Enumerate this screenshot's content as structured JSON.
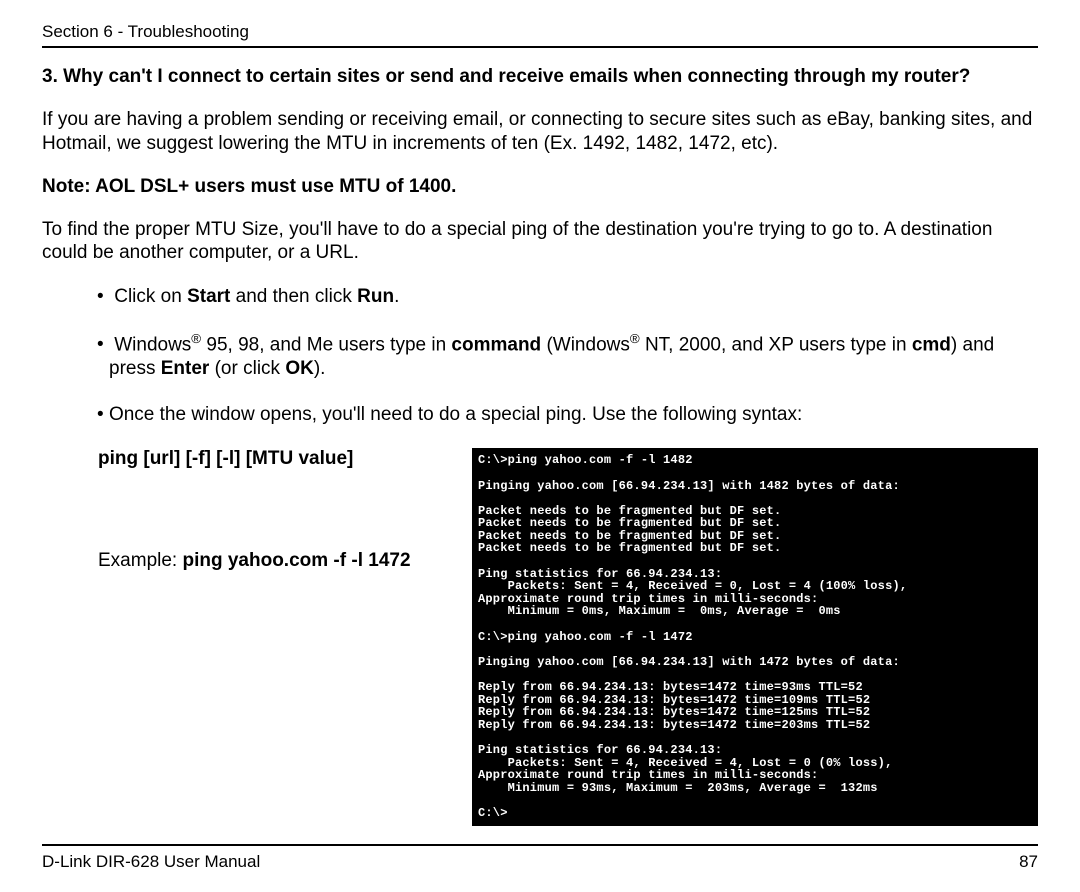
{
  "header": "Section 6 - Troubleshooting",
  "question": "3. Why can't I connect to certain sites or send and receive emails when connecting through my router?",
  "p1": "If you are having a problem sending or receiving email, or connecting to secure sites such as eBay, banking sites, and Hotmail, we suggest lowering the MTU in increments of ten (Ex. 1492, 1482, 1472, etc).",
  "note": "Note: AOL DSL+ users must use MTU of 1400.",
  "p2": "To find the proper MTU Size, you'll have to do a special ping of the destination you're trying to go to. A destination could be another computer, or a URL.",
  "steps": {
    "s1_a": "Click on ",
    "s1_b": "Start",
    "s1_c": " and then click ",
    "s1_d": "Run",
    "s1_e": ".",
    "s2_a": "Windows",
    "s2_b": " 95, 98, and Me users type in ",
    "s2_c": "command",
    "s2_d": " (Windows",
    "s2_e": " NT, 2000, and XP users type in ",
    "s2_f": "cmd",
    "s2_g": ") and press ",
    "s2_h": "Enter",
    "s2_i": " (or click ",
    "s2_j": "OK",
    "s2_k": ").",
    "s3": "Once the window opens, you'll need to do a special ping. Use the following syntax:"
  },
  "syntax": "ping [url] [-f] [-l] [MTU value]",
  "example_label": "Example: ",
  "example_cmd": "ping yahoo.com -f -l 1472",
  "terminal": "C:\\>ping yahoo.com -f -l 1482\n\nPinging yahoo.com [66.94.234.13] with 1482 bytes of data:\n\nPacket needs to be fragmented but DF set.\nPacket needs to be fragmented but DF set.\nPacket needs to be fragmented but DF set.\nPacket needs to be fragmented but DF set.\n\nPing statistics for 66.94.234.13:\n    Packets: Sent = 4, Received = 0, Lost = 4 (100% loss),\nApproximate round trip times in milli-seconds:\n    Minimum = 0ms, Maximum =  0ms, Average =  0ms\n\nC:\\>ping yahoo.com -f -l 1472\n\nPinging yahoo.com [66.94.234.13] with 1472 bytes of data:\n\nReply from 66.94.234.13: bytes=1472 time=93ms TTL=52\nReply from 66.94.234.13: bytes=1472 time=109ms TTL=52\nReply from 66.94.234.13: bytes=1472 time=125ms TTL=52\nReply from 66.94.234.13: bytes=1472 time=203ms TTL=52\n\nPing statistics for 66.94.234.13:\n    Packets: Sent = 4, Received = 4, Lost = 0 (0% loss),\nApproximate round trip times in milli-seconds:\n    Minimum = 93ms, Maximum =  203ms, Average =  132ms\n\nC:\\>",
  "footer_left": "D-Link DIR-628 User Manual",
  "footer_right": "87"
}
